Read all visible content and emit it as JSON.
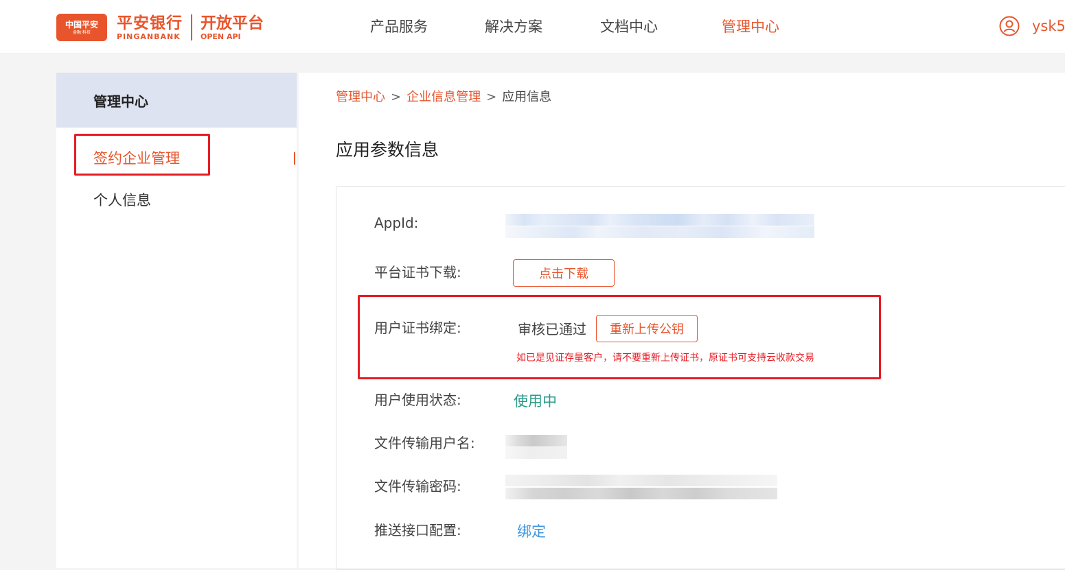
{
  "header": {
    "logo": {
      "badge_cn": "中国平安",
      "badge_sub": "金融·科技",
      "bank_cn": "平安银行",
      "bank_en": "PINGANBANK",
      "open_cn": "开放平台",
      "open_en": "OPEN API"
    },
    "nav": [
      {
        "label": "产品服务"
      },
      {
        "label": "解决方案"
      },
      {
        "label": "文档中心"
      },
      {
        "label": "管理中心"
      }
    ],
    "active_nav": "管理中心",
    "user_name": "ysk5",
    "user_icon": "user-circle-icon"
  },
  "sidebar": {
    "title": "管理中心",
    "items": [
      {
        "label": "签约企业管理"
      },
      {
        "label": "个人信息"
      }
    ],
    "active_item": "签约企业管理"
  },
  "breadcrumb": {
    "items": [
      "管理中心",
      "企业信息管理",
      "应用信息"
    ],
    "separator": ">"
  },
  "page_title": "应用参数信息",
  "fields": {
    "appid_label": "AppId:",
    "cert_download_label": "平台证书下载:",
    "cert_download_button": "点击下载",
    "cert_bind_label": "用户证书绑定:",
    "cert_bind_status": "审核已通过",
    "cert_bind_button": "重新上传公钥",
    "cert_bind_warning": "如已是见证存量客户，请不要重新上传证书，原证书可支持云收款交易",
    "user_status_label": "用户使用状态:",
    "user_status_value": "使用中",
    "ftp_user_label": "文件传输用户名:",
    "ftp_pass_label": "文件传输密码:",
    "push_label": "推送接口配置:",
    "push_link": "绑定"
  },
  "colors": {
    "brand": "#e8552d",
    "highlight_box": "#e51c23",
    "status_green": "#2a9a8a",
    "link_blue": "#3d96e0"
  }
}
